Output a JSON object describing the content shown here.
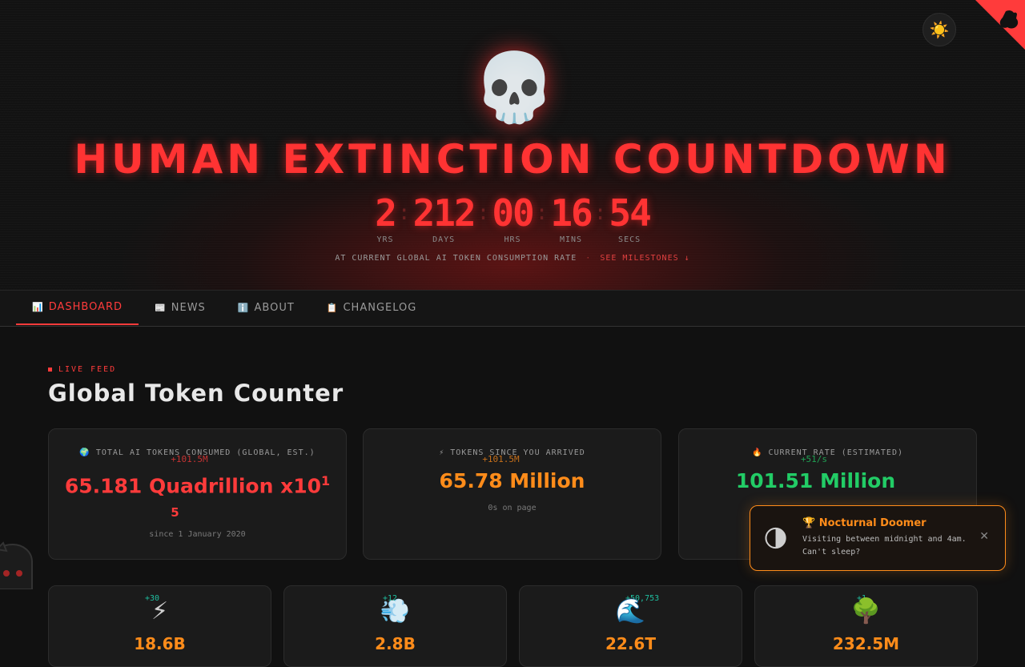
{
  "hero": {
    "skull_emoji": "💀",
    "title": "HUMAN EXTINCTION COUNTDOWN",
    "countdown": [
      {
        "value": "2",
        "label": "YRS"
      },
      {
        "value": "212",
        "label": "DAYS"
      },
      {
        "value": "00",
        "label": "HRS"
      },
      {
        "value": "16",
        "label": "MINS"
      },
      {
        "value": "54",
        "label": "SECS"
      }
    ],
    "subtitle": "AT CURRENT GLOBAL AI TOKEN CONSUMPTION RATE",
    "separator": "·",
    "milestones_link": "SEE MILESTONES ↓",
    "theme_toggle_icon": "☀️"
  },
  "nav": {
    "tabs": [
      {
        "icon": "📊",
        "label": "DASHBOARD",
        "active": true
      },
      {
        "icon": "📰",
        "label": "NEWS",
        "active": false
      },
      {
        "icon": "ℹ️",
        "label": "ABOUT",
        "active": false
      },
      {
        "icon": "📋",
        "label": "CHANGELOG",
        "active": false
      }
    ]
  },
  "main": {
    "eyebrow": "LIVE FEED",
    "title": "Global Token Counter",
    "cards": [
      {
        "label": "🌍 TOTAL AI TOKENS CONSUMED (GLOBAL, EST.)",
        "delta": "+101.5M",
        "value": "65.181 Quadrillion x10",
        "value_exp_a": "1",
        "value_exp_b": "5",
        "note": "since 1 January 2020",
        "accent": "#ff3b3b"
      },
      {
        "label": "⚡ TOKENS SINCE YOU ARRIVED",
        "delta": "+101.5M",
        "value": "65.78 Million",
        "note": "0s on page",
        "accent": "#ff8c1a"
      },
      {
        "label": "🔥 CURRENT RATE (ESTIMATED)",
        "delta": "+51/s",
        "value": "101.51 Million",
        "note": "",
        "accent": "#22cc66"
      }
    ],
    "stats": [
      {
        "emoji": "⚡",
        "delta": "+30",
        "value": "18.6B"
      },
      {
        "emoji": "💨",
        "delta": "+12",
        "value": "2.8B"
      },
      {
        "emoji": "🌊",
        "delta": "+50,753",
        "value": "22.6T"
      },
      {
        "emoji": "🌳",
        "delta": "+1",
        "value": "232.5M"
      }
    ]
  },
  "toast": {
    "icon": "🌗",
    "title": "🏆 Nocturnal Doomer",
    "body": "Visiting between midnight and 4am. Can't sleep?",
    "close": "✕"
  }
}
